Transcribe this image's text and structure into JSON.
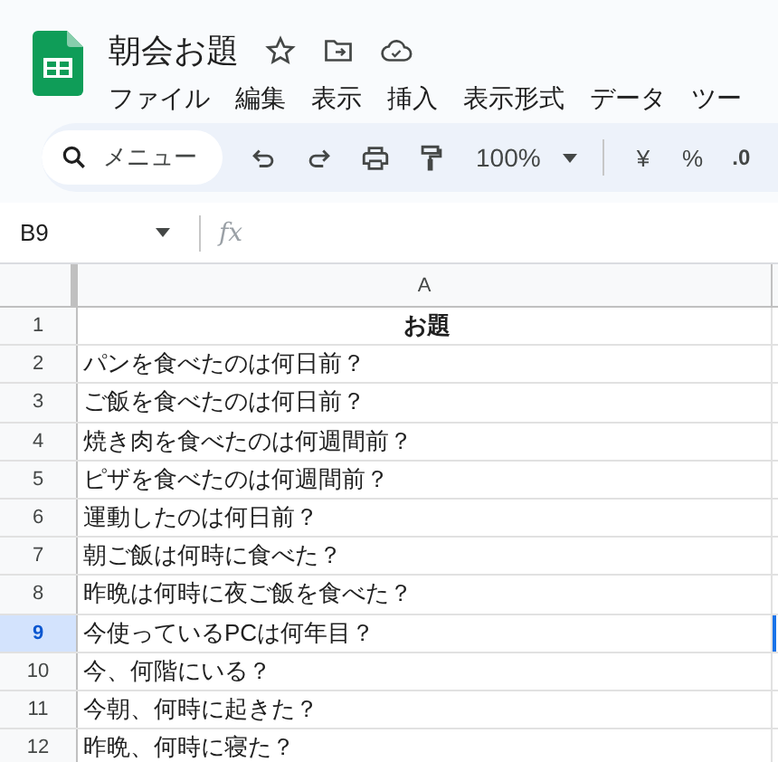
{
  "document": {
    "title": "朝会お題"
  },
  "menu": [
    "ファイル",
    "編集",
    "表示",
    "挿入",
    "表示形式",
    "データ",
    "ツー"
  ],
  "toolbar": {
    "search_label": "メニュー",
    "zoom": "100%",
    "currency": "¥",
    "percent": "%",
    "decimal": ".0"
  },
  "formula_bar": {
    "cell_ref": "B9",
    "fx": "fx"
  },
  "sheet": {
    "columns": [
      "A"
    ],
    "rows": [
      {
        "number": "1",
        "kind": "heading",
        "text": "お題",
        "selected": false
      },
      {
        "number": "2",
        "kind": "plain",
        "text": "パンを食べたのは何日前？",
        "selected": false
      },
      {
        "number": "3",
        "kind": "plain",
        "text": "ご飯を食べたのは何日前？",
        "selected": false
      },
      {
        "number": "4",
        "kind": "plain",
        "text": "焼き肉を食べたのは何週間前？",
        "selected": false
      },
      {
        "number": "5",
        "kind": "plain",
        "text": "ピザを食べたのは何週間前？",
        "selected": false
      },
      {
        "number": "6",
        "kind": "plain",
        "text": "運動したのは何日前？",
        "selected": false
      },
      {
        "number": "7",
        "kind": "plain",
        "text": "朝ご飯は何時に食べた？",
        "selected": false
      },
      {
        "number": "8",
        "kind": "plain",
        "text": "昨晩は何時に夜ご飯を食べた？",
        "selected": false
      },
      {
        "number": "9",
        "kind": "plain",
        "text": "今使っているPCは何年目？",
        "selected": true
      },
      {
        "number": "10",
        "kind": "plain",
        "text": "今、何階にいる？",
        "selected": false
      },
      {
        "number": "11",
        "kind": "plain",
        "text": "今朝、何時に起きた？",
        "selected": false
      },
      {
        "number": "12",
        "kind": "plain",
        "text": "昨晩、何時に寝た？",
        "selected": false
      }
    ]
  }
}
